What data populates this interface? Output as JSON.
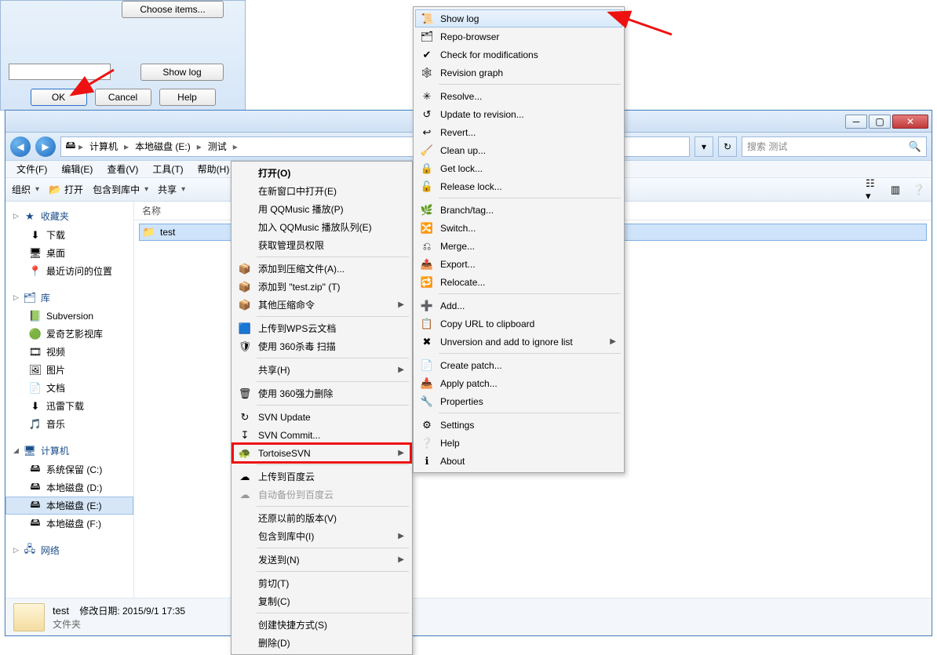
{
  "dialog": {
    "choose_items": "Choose items...",
    "show_log": "Show log",
    "ok": "OK",
    "cancel": "Cancel",
    "help": "Help"
  },
  "explorer": {
    "breadcrumbs": {
      "seg_computer": "计算机",
      "seg_drive": "本地磁盘 (E:)",
      "seg_folder": "测试"
    },
    "search_placeholder": "搜索 测试",
    "menubar": {
      "file": "文件(F)",
      "edit": "编辑(E)",
      "view": "查看(V)",
      "tools": "工具(T)",
      "help": "帮助(H)"
    },
    "toolbar": {
      "organize": "组织",
      "open": "打开",
      "include": "包含到库中",
      "share": "共享"
    },
    "columns": {
      "name": "名称"
    },
    "sidebar": {
      "favorites": "收藏夹",
      "fav_items": [
        "下载",
        "桌面",
        "最近访问的位置"
      ],
      "libraries": "库",
      "lib_items": [
        "Subversion",
        "爱奇艺影视库",
        "视频",
        "图片",
        "文档",
        "迅雷下载",
        "音乐"
      ],
      "computer": "计算机",
      "drives": [
        "系统保留 (C:)",
        "本地磁盘 (D:)",
        "本地磁盘 (E:)",
        "本地磁盘 (F:)"
      ],
      "network": "网络"
    },
    "file_selected": "test",
    "status": {
      "name": "test",
      "date_label": "修改日期:",
      "date_value": "2015/9/1 17:35",
      "type": "文件夹"
    }
  },
  "ctx1_items": [
    {
      "label": "打开(O)",
      "bold": true
    },
    {
      "label": "在新窗口中打开(E)"
    },
    {
      "label": "用 QQMusic 播放(P)"
    },
    {
      "label": "加入 QQMusic 播放队列(E)"
    },
    {
      "label": "获取管理员权限"
    },
    {
      "sep": true
    },
    {
      "label": "添加到压缩文件(A)...",
      "icon": "archive"
    },
    {
      "label": "添加到 \"test.zip\" (T)",
      "icon": "archive"
    },
    {
      "label": "其他压缩命令",
      "icon": "archive",
      "sub": true
    },
    {
      "sep": true
    },
    {
      "label": "上传到WPS云文档",
      "icon": "wps"
    },
    {
      "label": "使用 360杀毒 扫描",
      "icon": "shield"
    },
    {
      "sep": true
    },
    {
      "label": "共享(H)",
      "sub": true
    },
    {
      "sep": true
    },
    {
      "label": "使用 360强力删除",
      "icon": "trash"
    },
    {
      "sep": true
    },
    {
      "label": "SVN Update",
      "icon": "svn-up"
    },
    {
      "label": "SVN Commit...",
      "icon": "svn-commit"
    },
    {
      "label": "TortoiseSVN",
      "icon": "tortoise",
      "sub": true,
      "red": true
    },
    {
      "sep": true
    },
    {
      "label": "上传到百度云",
      "icon": "cloud"
    },
    {
      "label": "自动备份到百度云",
      "disabled": true,
      "icon": "cloud-grey"
    },
    {
      "sep": true
    },
    {
      "label": "还原以前的版本(V)"
    },
    {
      "label": "包含到库中(I)",
      "sub": true
    },
    {
      "sep": true
    },
    {
      "label": "发送到(N)",
      "sub": true
    },
    {
      "sep": true
    },
    {
      "label": "剪切(T)"
    },
    {
      "label": "复制(C)"
    },
    {
      "sep": true
    },
    {
      "label": "创建快捷方式(S)"
    },
    {
      "label": "删除(D)"
    }
  ],
  "ctx2_items": [
    {
      "label": "Show log",
      "icon": "log",
      "sel": true
    },
    {
      "label": "Repo-browser",
      "icon": "repo"
    },
    {
      "label": "Check for modifications",
      "icon": "check"
    },
    {
      "label": "Revision graph",
      "icon": "graph"
    },
    {
      "sep": true
    },
    {
      "label": "Resolve...",
      "icon": "resolve"
    },
    {
      "label": "Update to revision...",
      "icon": "update"
    },
    {
      "label": "Revert...",
      "icon": "revert"
    },
    {
      "label": "Clean up...",
      "icon": "clean"
    },
    {
      "label": "Get lock...",
      "icon": "lock"
    },
    {
      "label": "Release lock...",
      "icon": "unlock"
    },
    {
      "sep": true
    },
    {
      "label": "Branch/tag...",
      "icon": "branch"
    },
    {
      "label": "Switch...",
      "icon": "switch"
    },
    {
      "label": "Merge...",
      "icon": "merge"
    },
    {
      "label": "Export...",
      "icon": "export"
    },
    {
      "label": "Relocate...",
      "icon": "relocate"
    },
    {
      "sep": true
    },
    {
      "label": "Add...",
      "icon": "add"
    },
    {
      "label": "Copy URL to clipboard",
      "icon": "copyurl"
    },
    {
      "label": "Unversion and add to ignore list",
      "icon": "ignore",
      "sub": true
    },
    {
      "sep": true
    },
    {
      "label": "Create patch...",
      "icon": "patch"
    },
    {
      "label": "Apply patch...",
      "icon": "apply"
    },
    {
      "label": "Properties",
      "icon": "props"
    },
    {
      "sep": true
    },
    {
      "label": "Settings",
      "icon": "settings"
    },
    {
      "label": "Help",
      "icon": "help"
    },
    {
      "label": "About",
      "icon": "about"
    }
  ]
}
